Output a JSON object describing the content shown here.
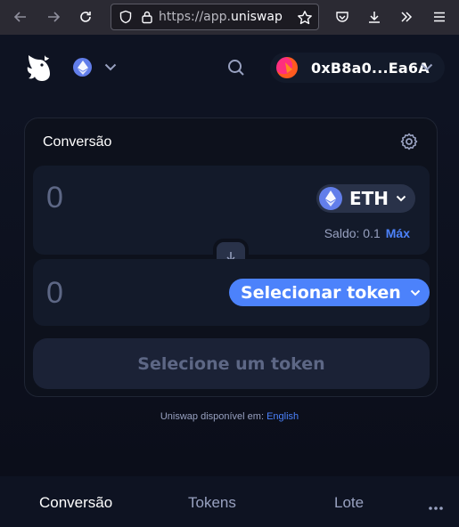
{
  "browser": {
    "url_prefix": "https://app.",
    "url_host": "uniswap"
  },
  "header": {
    "wallet_address": "0xB8a0...Ea6A"
  },
  "swap": {
    "title": "Conversão",
    "input_amount": "0",
    "input_token": "ETH",
    "balance_label": "Saldo: 0.1",
    "max_label": "Máx",
    "output_amount": "0",
    "select_token_label": "Selecionar token",
    "cta_label": "Selecione um token"
  },
  "footer": {
    "availability_text": "Uniswap disponível em:",
    "language_link": "English"
  },
  "bottom_nav": {
    "items": [
      {
        "label": "Conversão",
        "active": true
      },
      {
        "label": "Tokens",
        "active": false
      },
      {
        "label": "Lote",
        "active": false
      }
    ]
  },
  "colors": {
    "accent": "#4c82fb",
    "background": "#0d111c",
    "surface": "#131a2a",
    "eth": "#627eea"
  },
  "icons": [
    "back-arrow-icon",
    "forward-arrow-icon",
    "reload-icon",
    "shield-icon",
    "lock-icon",
    "star-icon",
    "pocket-icon",
    "download-icon",
    "overflow-icon",
    "menu-icon",
    "uniswap-logo",
    "ethereum-icon",
    "chevron-down-icon",
    "search-icon",
    "settings-icon",
    "arrow-down-icon",
    "more-icon"
  ]
}
